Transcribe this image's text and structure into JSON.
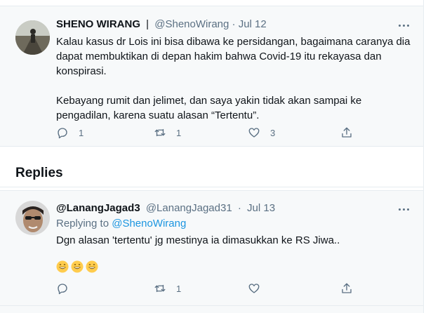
{
  "main_tweet": {
    "name": "SHENO WIRANG",
    "separator": "|",
    "handle": "@ShenoWirang",
    "dot": "·",
    "date": "Jul 12",
    "paragraph1": "Kalau kasus dr Lois ini bisa dibawa ke persidangan, bagaimana caranya dia dapat membuktikan di depan hakim bahwa Covid-19 itu rekayasa dan konspirasi.",
    "paragraph2": "Kebayang rumit dan jelimet, dan saya yakin tidak akan sampai ke pengadilan, karena suatu alasan “Tertentu”.",
    "reply_count": "1",
    "retweet_count": "1",
    "like_count": "3",
    "avatar_icon": "profile-photo"
  },
  "replies_section": {
    "title": "Replies"
  },
  "reply_tweet": {
    "name": "@LanangJagad3",
    "handle": "@LanangJagad31",
    "dot": "·",
    "date": "Jul 13",
    "replying_prefix": "Replying to",
    "replying_handle": "@ShenoWirang",
    "text": "Dgn alasan 'tertentu' jg mestinya ia dimasukkan ke RS Jiwa..",
    "emojis": [
      "😄",
      "😄",
      "😄"
    ],
    "reply_count": "",
    "retweet_count": "1",
    "like_count": "",
    "avatar_icon": "profile-photo"
  },
  "colors": {
    "accent": "#1b95e0",
    "secondary_text": "#5b7083",
    "tweet_bg": "#f7f9fa",
    "border": "#e6ecf0"
  }
}
